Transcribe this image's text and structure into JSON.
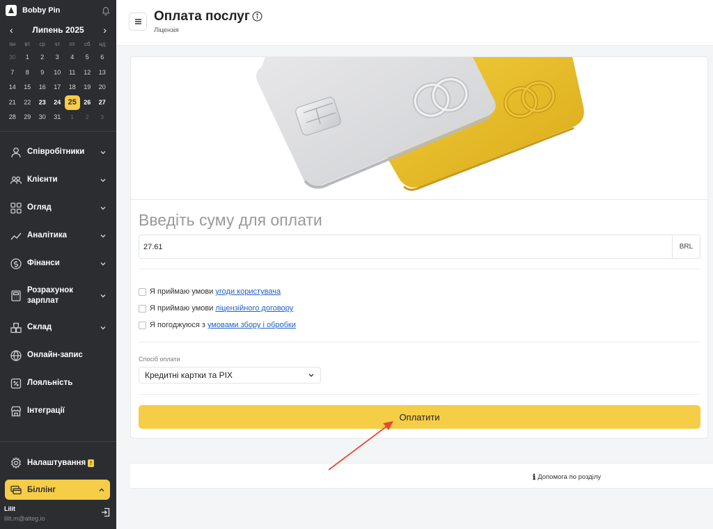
{
  "brand": {
    "name": "Bobby Pin"
  },
  "calendar": {
    "month": "Липень 2025",
    "prev": "‹",
    "next": "›",
    "weekdays": [
      "пн",
      "вт",
      "ср",
      "чт",
      "пт",
      "сб",
      "нд"
    ],
    "rows": [
      [
        "30",
        "1",
        "2",
        "3",
        "4",
        "5",
        "6"
      ],
      [
        "7",
        "8",
        "9",
        "10",
        "11",
        "12",
        "13"
      ],
      [
        "14",
        "15",
        "16",
        "17",
        "18",
        "19",
        "20"
      ],
      [
        "21",
        "22",
        "23",
        "24",
        "25",
        "26",
        "27"
      ],
      [
        "28",
        "29",
        "30",
        "31",
        "1",
        "2",
        "3"
      ]
    ]
  },
  "nav": {
    "employees": "Співробітники",
    "clients": "Клієнти",
    "overview": "Огляд",
    "analytics": "Аналітика",
    "finances": "Фінанси",
    "payroll": "Розрахунок зарплат",
    "warehouse": "Склад",
    "online": "Онлайн-запис",
    "loyalty": "Лояльність",
    "integrations": "Інтеграції",
    "settings": "Налаштування",
    "settings_badge": "!",
    "billing": "Біллінг"
  },
  "user": {
    "name": "Lilit",
    "email": "lilit.m@alteg.io"
  },
  "header": {
    "title": "Оплата послуг",
    "subtitle": "Ліцензія"
  },
  "payment": {
    "amount_title": "Введіть суму для оплати",
    "amount_value": "27.61",
    "currency": "BRL",
    "terms": [
      {
        "prefix": "Я приймаю умови",
        "link": "угоди користувача"
      },
      {
        "prefix": "Я приймаю умови",
        "link": "ліцензійного договору"
      },
      {
        "prefix": "Я погоджуюся з",
        "link": "умовами збору і обробки"
      }
    ],
    "method_label": "Спосіб оплати",
    "method_value": "Кредитні картки та PIX",
    "pay_button": "Оплатити"
  },
  "footer": {
    "help": "Допомога по розділу",
    "help_icon": "ℹ"
  },
  "colors": {
    "accent": "#f6cd47",
    "sidebar": "#2b2d31",
    "link": "#1f5fcc",
    "annotation": "#e8492f"
  }
}
